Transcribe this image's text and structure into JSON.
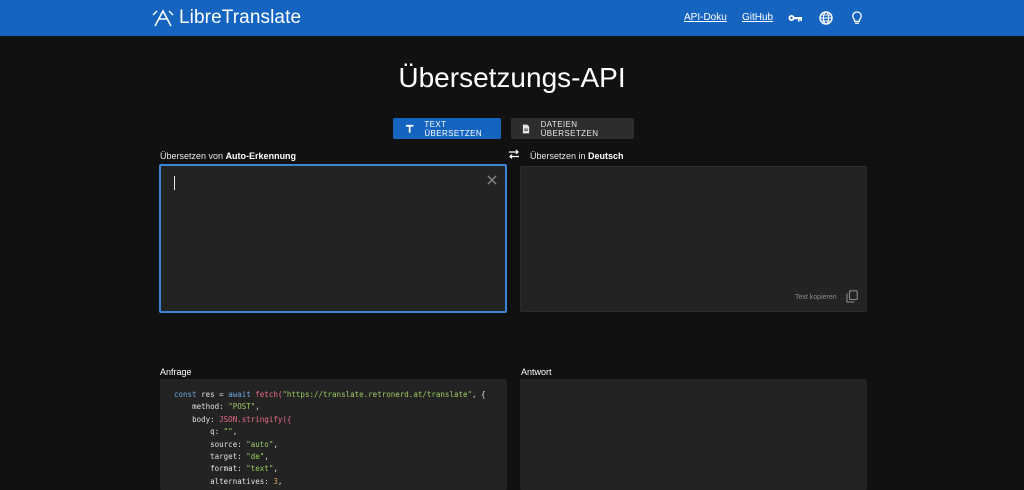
{
  "colors": {
    "navbar": "#1565c0",
    "accent": "#1565c0",
    "background": "#111111",
    "panel": "#232323"
  },
  "navbar": {
    "brand": "LibreTranslate",
    "links": [
      "API-Doku",
      "GitHub"
    ],
    "icons": [
      "key-icon",
      "globe-icon",
      "lightbulb-icon"
    ]
  },
  "page": {
    "title": "Übersetzungs-API"
  },
  "modes": {
    "text_label": "TEXT ÜBERSETZEN",
    "files_label": "DATEIEN ÜBERSETZEN",
    "active": "text"
  },
  "source": {
    "label_prefix": "Übersetzen von",
    "language": "Auto-Erkennung",
    "value": ""
  },
  "target": {
    "label_prefix": "Übersetzen in",
    "language": "Deutsch",
    "value": "",
    "copy_label": "Text kopieren"
  },
  "request": {
    "label": "Anfrage",
    "code": {
      "l1_a": "const",
      "l1_b": "res",
      "l1_c": "=",
      "l1_d": "await",
      "l1_e": "fetch(",
      "l1_f": "\"https://translate.retronerd.at/translate\"",
      "l1_g": ", {",
      "l2_k": "method:",
      "l2_v": "\"POST\"",
      "l2_p": ",",
      "l3_k": "body:",
      "l3_f": "JSON.stringify({",
      "l4_k": "q:",
      "l4_v": "\"\"",
      "l4_p": ",",
      "l5_k": "source:",
      "l5_v": "\"auto\"",
      "l5_p": ",",
      "l6_k": "target:",
      "l6_v": "\"de\"",
      "l6_p": ",",
      "l7_k": "format:",
      "l7_v": "\"text\"",
      "l7_p": ",",
      "l8_k": "alternatives:",
      "l8_v": "3",
      "l8_p": ","
    }
  },
  "response": {
    "label": "Antwort",
    "value": ""
  }
}
